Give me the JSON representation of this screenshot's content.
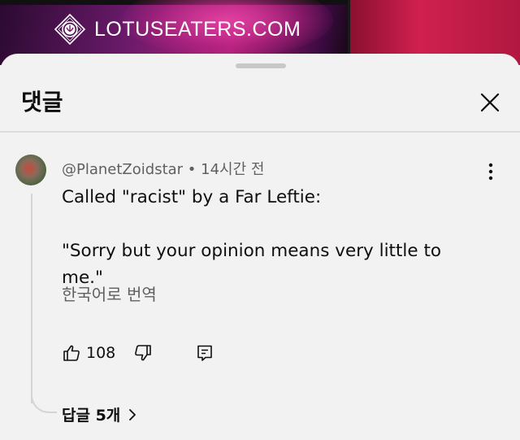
{
  "video": {
    "logo_text": "LOTUSEATERS.COM",
    "icons": {
      "logo": "lotus-logo-icon"
    }
  },
  "sheet": {
    "title": "댓글",
    "icons": {
      "close": "close-icon"
    }
  },
  "comment": {
    "handle": "@PlanetZoidstar",
    "separator": "•",
    "time": "14시간 전",
    "line1": "Called \"racist\" by a Far Leftie:",
    "line2": "\"Sorry but your opinion means very little to me.\"",
    "translate_label": "한국어로 번역",
    "like_count": "108",
    "replies_label": "답글 5개",
    "icons": {
      "more": "more-vert-icon",
      "like": "thumbs-up-icon",
      "dislike": "thumbs-down-icon",
      "reply": "reply-icon",
      "chevron": "chevron-right-icon"
    }
  },
  "colors": {
    "text": "#0f0f0f",
    "secondary_text": "#606060",
    "sheet_bg": "#f2f2f2"
  }
}
